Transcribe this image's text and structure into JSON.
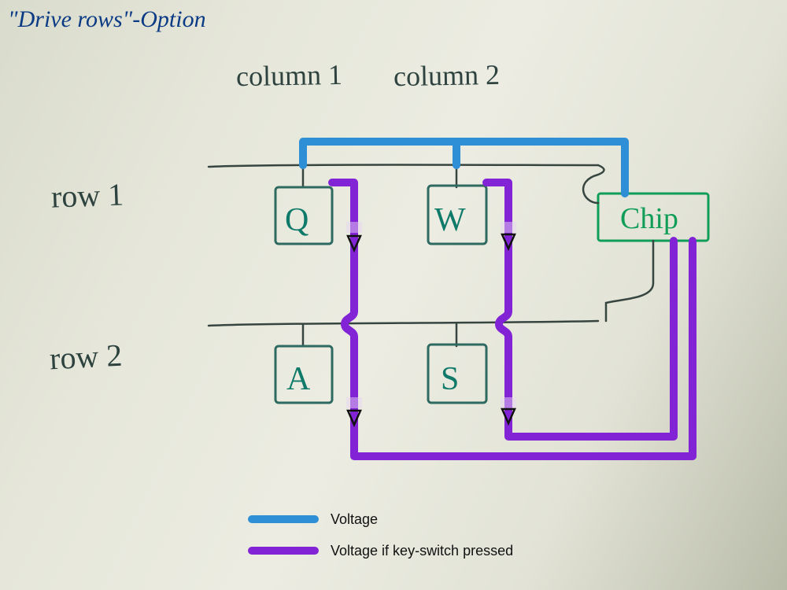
{
  "title": "\"Drive rows\"-Option",
  "labels": {
    "col1": "column 1",
    "col2": "column 2",
    "row1": "row 1",
    "row2": "row 2",
    "chip": "Chip"
  },
  "keys": {
    "Q": "Q",
    "W": "W",
    "A": "A",
    "S": "S"
  },
  "legend": {
    "voltage": "Voltage",
    "voltage_pressed": "Voltage if key-switch pressed"
  },
  "colors": {
    "voltage": "#2f8fd6",
    "pressed": "#8223d6",
    "ink": "#2e433f",
    "key": "#2e6a60",
    "chip": "#0f9d58",
    "title": "#0b3a85"
  }
}
